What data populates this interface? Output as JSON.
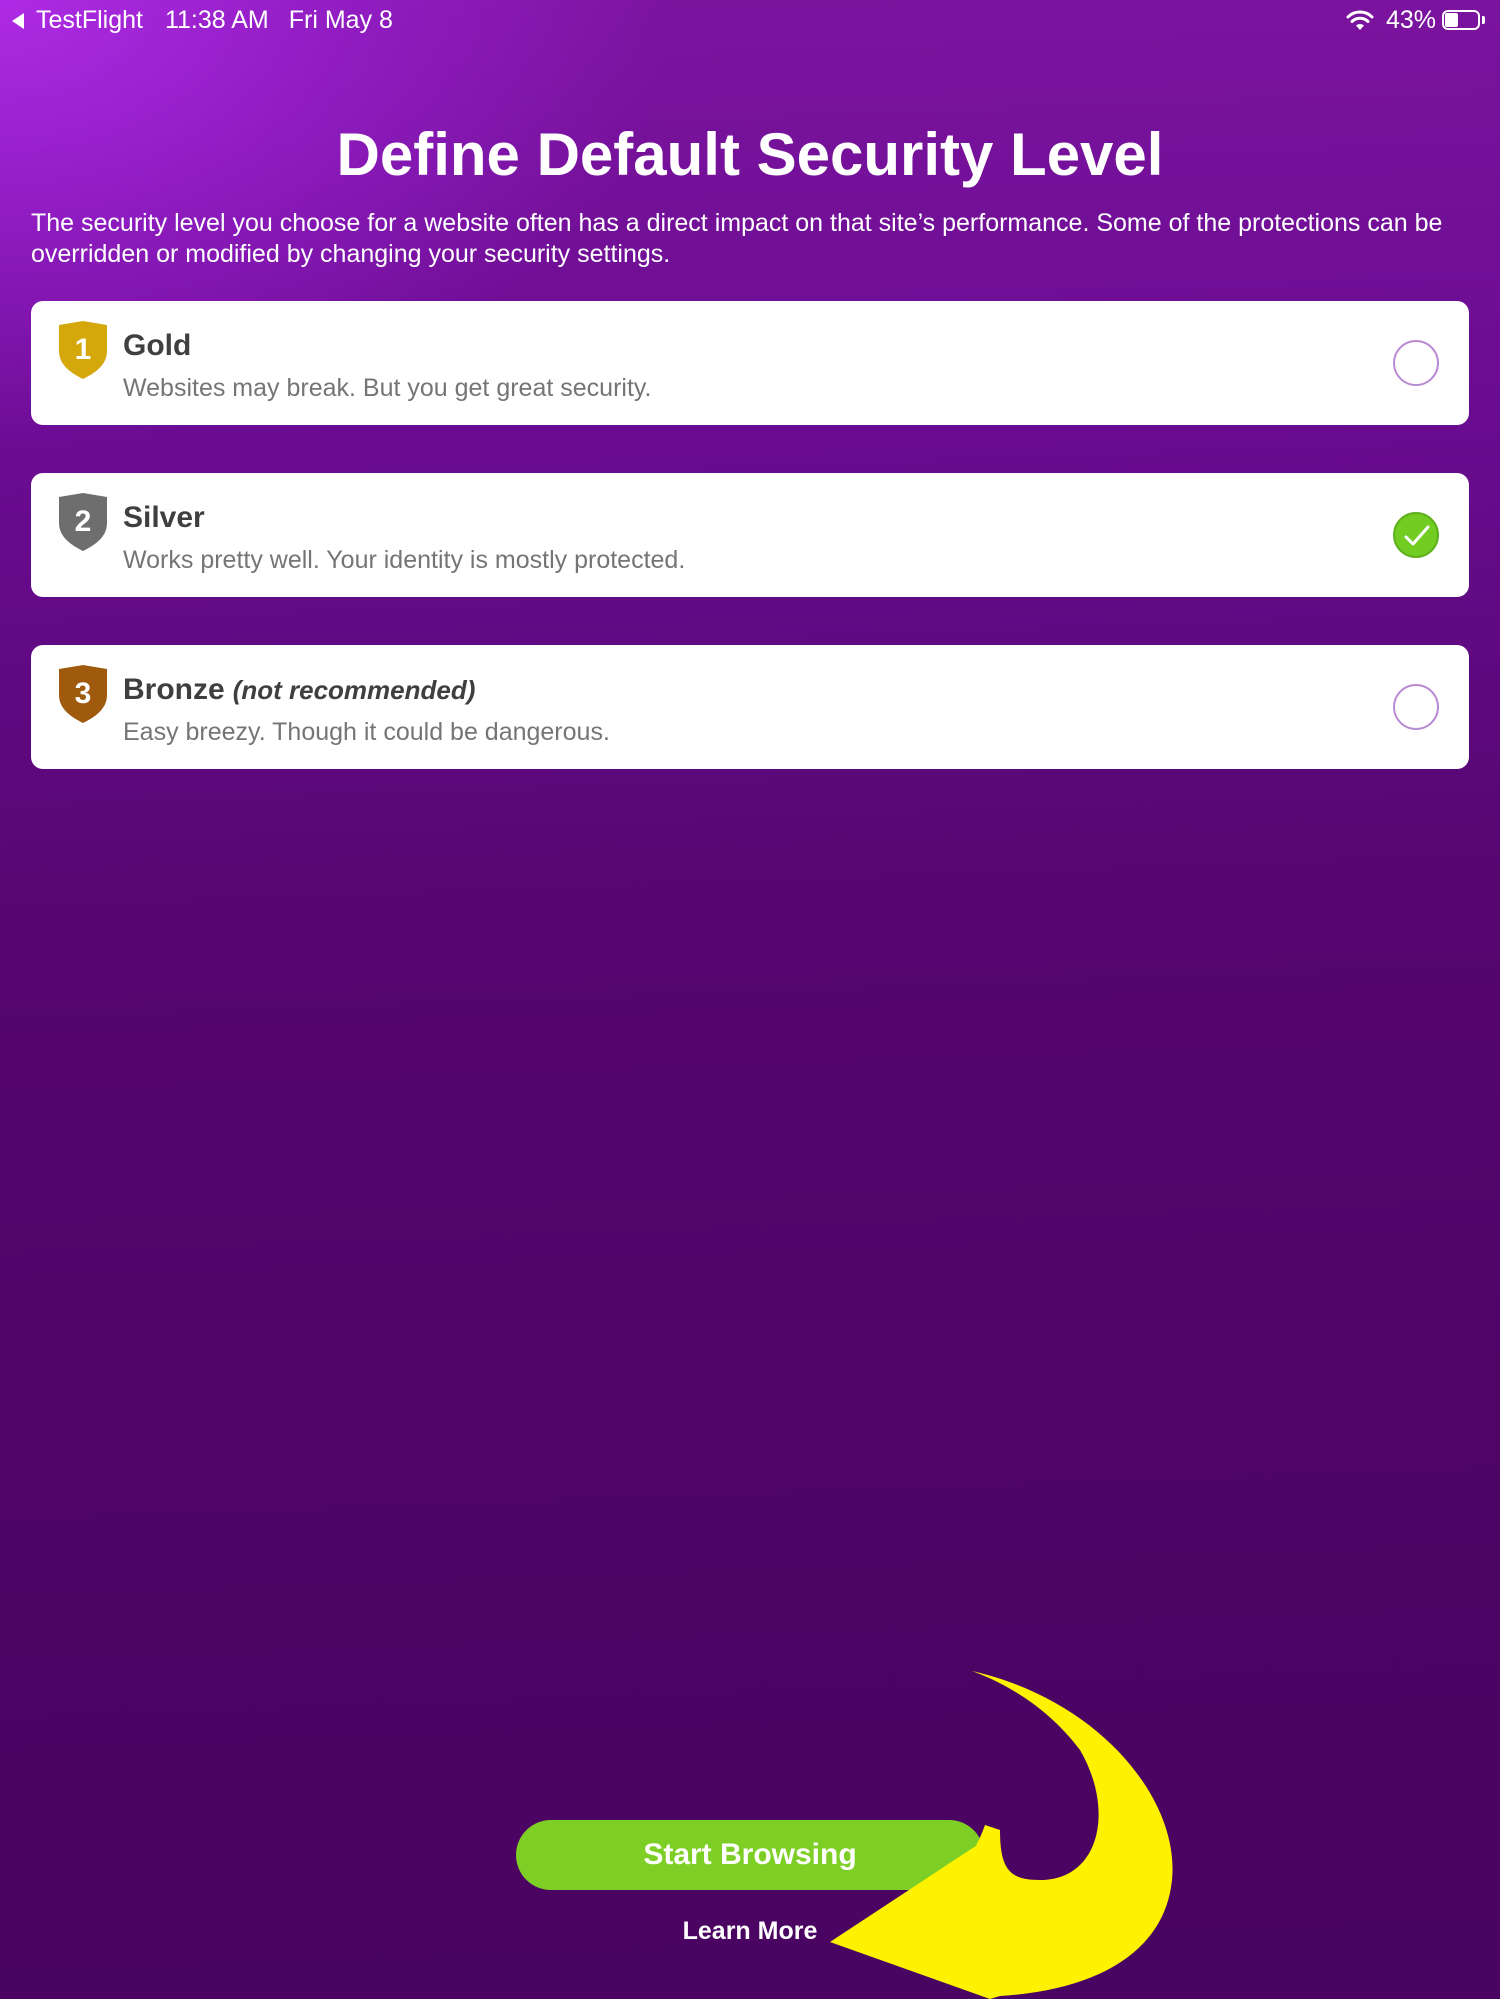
{
  "status_bar": {
    "back_app": "TestFlight",
    "time": "11:38 AM",
    "date": "Fri May 8",
    "battery_percent": "43%",
    "battery_level": 0.43
  },
  "page": {
    "title": "Define Default Security Level",
    "intro": "The security level you choose for a website often has a direct impact on that site’s performance. Some of the protections can be overridden or modified by changing your security settings."
  },
  "levels": [
    {
      "number": "1",
      "name": "Gold",
      "note": "",
      "description": "Websites may break. But you get great security.",
      "selected": false,
      "shield_color": "#d4a80a"
    },
    {
      "number": "2",
      "name": "Silver",
      "note": "",
      "description": "Works pretty well. Your identity is mostly protected.",
      "selected": true,
      "shield_color": "#6e6e6e"
    },
    {
      "number": "3",
      "name": "Bronze",
      "note": "(not recommended)",
      "description": "Easy breezy. Though it could be dangerous.",
      "selected": false,
      "shield_color": "#a05a0e"
    }
  ],
  "actions": {
    "start_browsing": "Start Browsing",
    "learn_more": "Learn More"
  },
  "colors": {
    "accent_green": "#7ecf25",
    "background_purple": "#4e0566",
    "annotation_arrow": "#fff200"
  },
  "icons": {
    "back": "chevron-left-icon",
    "wifi": "wifi-icon",
    "battery": "battery-icon",
    "shield": "shield-icon",
    "check": "checkmark-icon"
  }
}
